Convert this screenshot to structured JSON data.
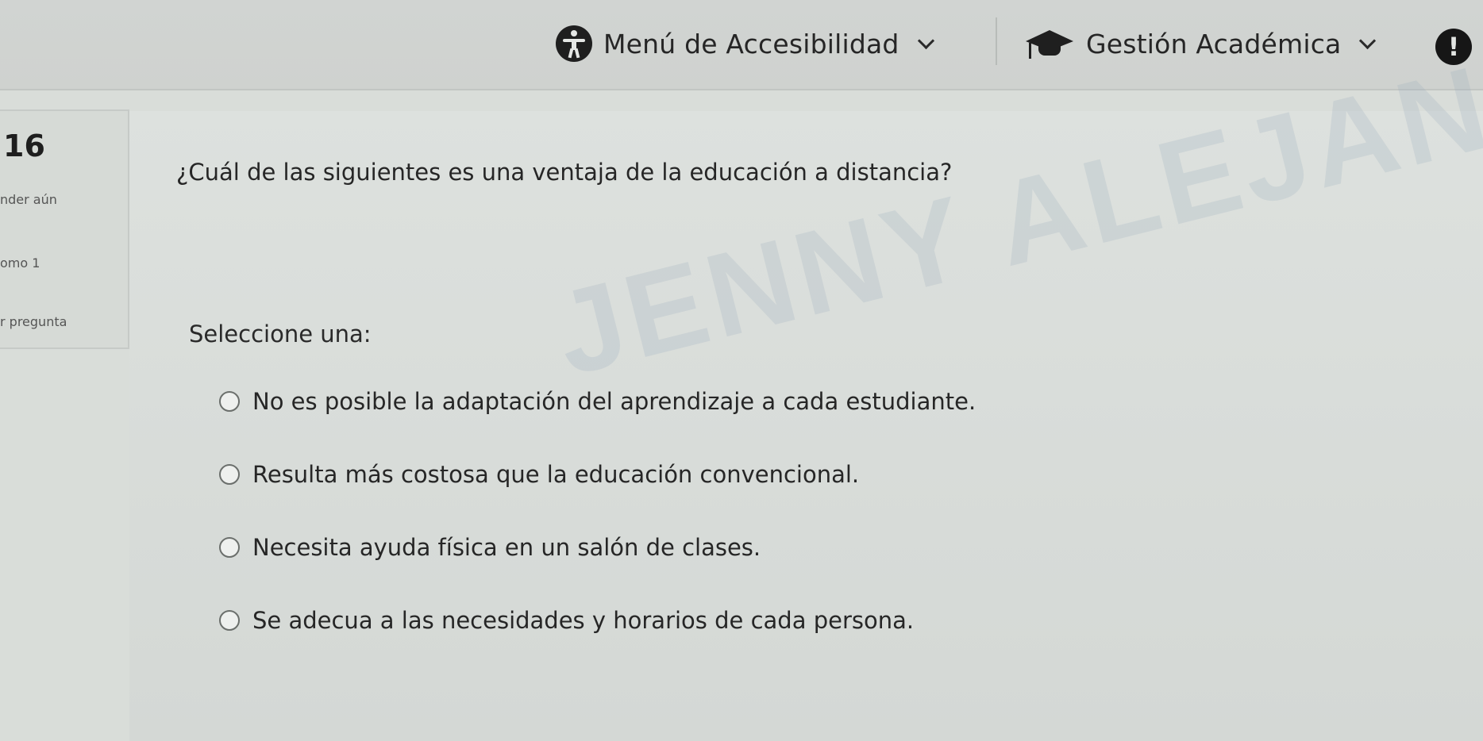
{
  "topbar": {
    "accessibility_menu": {
      "label": "Menú de Accesibilidad",
      "icon": "accessibility-icon"
    },
    "academic_menu": {
      "label": "Gestión Académica",
      "icon": "graduation-cap-icon"
    },
    "alert": {
      "icon": "alert-icon",
      "symbol": "!"
    }
  },
  "question_info": {
    "number": "16",
    "status": "nder aún",
    "score": "omo 1",
    "flag": "r pregunta"
  },
  "question": {
    "text": "¿Cuál de las siguientes es una ventaja de la educación a distancia?",
    "prompt": "Seleccione una:",
    "options": [
      {
        "label": "No es posible la adaptación del aprendizaje a cada estudiante.",
        "selected": false
      },
      {
        "label": "Resulta más costosa que la educación convencional.",
        "selected": false
      },
      {
        "label": "Necesita ayuda física en un salón de clases.",
        "selected": false
      },
      {
        "label": "Se adecua a las necesidades y horarios de cada persona.",
        "selected": false
      }
    ]
  },
  "watermark": "JENNY ALEJANDRA SA"
}
